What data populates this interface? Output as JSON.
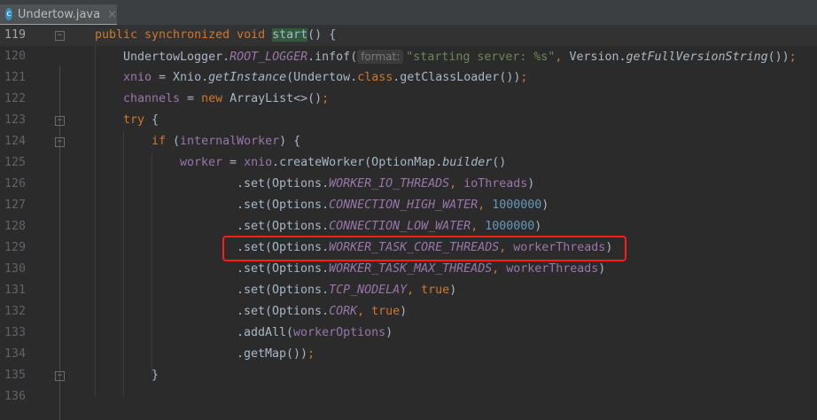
{
  "tab": {
    "title": "Undertow.java",
    "icon": "java-class-icon",
    "icon_letter": "c",
    "close": "×"
  },
  "lines": [
    {
      "n": "119",
      "indent": 0,
      "cur": true,
      "fold": true,
      "t": [
        [
          "kw",
          "public synchronized void "
        ],
        [
          "hl",
          "start"
        ],
        [
          "",
          "() {"
        ]
      ]
    },
    {
      "n": "120",
      "indent": 4,
      "t": [
        [
          "",
          "UndertowLogger."
        ],
        [
          "fld",
          "ROOT_LOGGER"
        ],
        [
          "",
          ".infof("
        ],
        [
          "hint",
          "format:"
        ],
        [
          "str",
          "\"starting server: %s\""
        ],
        [
          "kw",
          ", "
        ],
        [
          "",
          "Version."
        ],
        [
          "it",
          "getFullVersionString"
        ],
        [
          "",
          "())"
        ],
        [
          "kw",
          ";"
        ]
      ]
    },
    {
      "n": "121",
      "indent": 4,
      "t": [
        [
          "var",
          "xnio"
        ],
        [
          "",
          " = Xnio."
        ],
        [
          "it",
          "getInstance"
        ],
        [
          "",
          "(Undertow."
        ],
        [
          "kw",
          "class"
        ],
        [
          "",
          ".getClassLoader())"
        ],
        [
          "kw",
          ";"
        ]
      ]
    },
    {
      "n": "122",
      "indent": 4,
      "t": [
        [
          "var",
          "channels"
        ],
        [
          "",
          " = "
        ],
        [
          "kw",
          "new "
        ],
        [
          "",
          "ArrayList<>()"
        ],
        [
          "kw",
          ";"
        ]
      ]
    },
    {
      "n": "123",
      "indent": 4,
      "fold": true,
      "t": [
        [
          "kw",
          "try "
        ],
        [
          "",
          "{"
        ]
      ]
    },
    {
      "n": "124",
      "indent": 8,
      "fold": true,
      "t": [
        [
          "kw",
          "if "
        ],
        [
          "",
          "("
        ],
        [
          "var",
          "internalWorker"
        ],
        [
          "",
          ") {"
        ]
      ]
    },
    {
      "n": "125",
      "indent": 12,
      "t": [
        [
          "var",
          "worker"
        ],
        [
          "",
          " = "
        ],
        [
          "var",
          "xnio"
        ],
        [
          "",
          ".createWorker(OptionMap."
        ],
        [
          "it",
          "builder"
        ],
        [
          "",
          "()"
        ]
      ]
    },
    {
      "n": "126",
      "indent": 20,
      "t": [
        [
          "",
          ".set(Options."
        ],
        [
          "fld",
          "WORKER_IO_THREADS"
        ],
        [
          "kw",
          ", "
        ],
        [
          "var",
          "ioThreads"
        ],
        [
          "",
          ")"
        ]
      ]
    },
    {
      "n": "127",
      "indent": 20,
      "t": [
        [
          "",
          ".set(Options."
        ],
        [
          "fld",
          "CONNECTION_HIGH_WATER"
        ],
        [
          "kw",
          ", "
        ],
        [
          "num",
          "1000000"
        ],
        [
          "",
          ")"
        ]
      ]
    },
    {
      "n": "128",
      "indent": 20,
      "t": [
        [
          "",
          ".set(Options."
        ],
        [
          "fld",
          "CONNECTION_LOW_WATER"
        ],
        [
          "kw",
          ", "
        ],
        [
          "num",
          "1000000"
        ],
        [
          "",
          ")"
        ]
      ]
    },
    {
      "n": "129",
      "indent": 20,
      "t": [
        [
          "",
          ".set(Options."
        ],
        [
          "fld",
          "WORKER_TASK_CORE_THREADS"
        ],
        [
          "kw",
          ", "
        ],
        [
          "var",
          "workerThreads"
        ],
        [
          "",
          ")"
        ]
      ]
    },
    {
      "n": "130",
      "indent": 20,
      "t": [
        [
          "",
          ".set(Options."
        ],
        [
          "fld",
          "WORKER_TASK_MAX_THREADS"
        ],
        [
          "kw",
          ", "
        ],
        [
          "var",
          "workerThreads"
        ],
        [
          "",
          ")"
        ]
      ]
    },
    {
      "n": "131",
      "indent": 20,
      "t": [
        [
          "",
          ".set(Options."
        ],
        [
          "fld",
          "TCP_NODELAY"
        ],
        [
          "kw",
          ", true"
        ],
        [
          "",
          ")"
        ]
      ]
    },
    {
      "n": "132",
      "indent": 20,
      "t": [
        [
          "",
          ".set(Options."
        ],
        [
          "fld",
          "CORK"
        ],
        [
          "kw",
          ", true"
        ],
        [
          "",
          ")"
        ]
      ]
    },
    {
      "n": "133",
      "indent": 20,
      "t": [
        [
          "",
          ".addAll("
        ],
        [
          "var",
          "workerOptions"
        ],
        [
          "",
          ")"
        ]
      ]
    },
    {
      "n": "134",
      "indent": 20,
      "t": [
        [
          "",
          ".getMap())"
        ],
        [
          "kw",
          ";"
        ]
      ]
    },
    {
      "n": "135",
      "indent": 8,
      "fold": true,
      "t": [
        [
          "",
          "}"
        ]
      ]
    },
    {
      "n": "136",
      "indent": 0,
      "t": []
    }
  ],
  "highlight_line": "129"
}
